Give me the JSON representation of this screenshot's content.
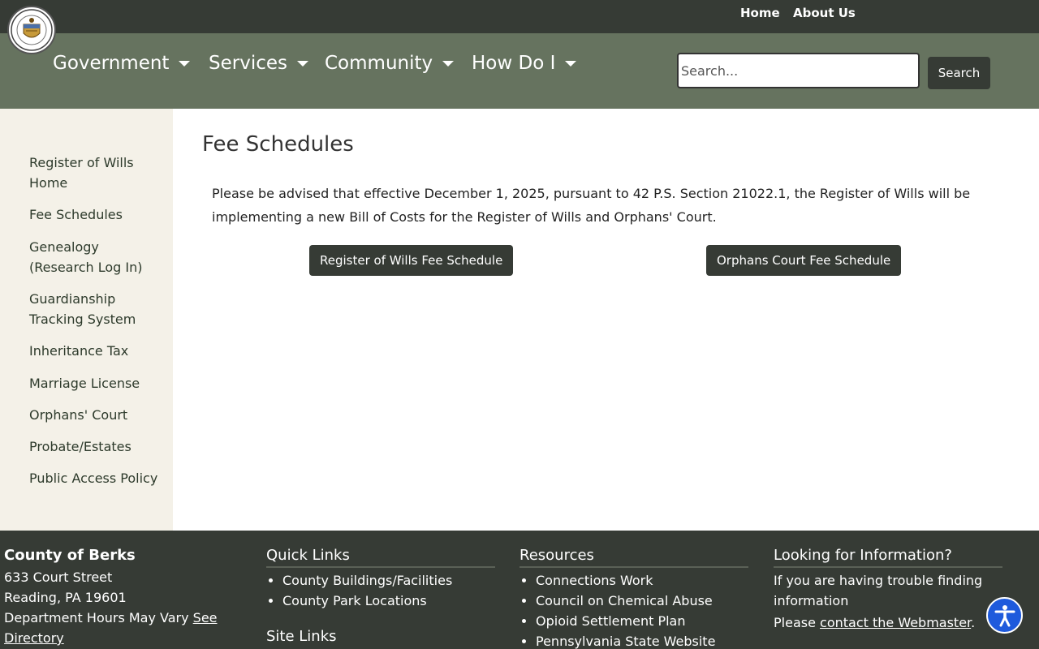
{
  "topbar": {
    "home_label": "Home",
    "about_label": "About Us"
  },
  "seal": {
    "icon": "county-seal-icon"
  },
  "nav": {
    "items": [
      {
        "label": "Government"
      },
      {
        "label": "Services"
      },
      {
        "label": "Community"
      },
      {
        "label": "How Do I"
      }
    ],
    "search": {
      "placeholder": "Search...",
      "button_label": "Search"
    }
  },
  "sidebar": {
    "items": [
      {
        "label": "Register of Wills Home"
      },
      {
        "label": "Fee Schedules"
      },
      {
        "label": "Genealogy (Research Log In)"
      },
      {
        "label": "Guardianship Tracking System"
      },
      {
        "label": "Inheritance Tax"
      },
      {
        "label": "Marriage License"
      },
      {
        "label": "Orphans' Court"
      },
      {
        "label": "Probate/Estates"
      },
      {
        "label": "Public Access Policy"
      }
    ]
  },
  "main": {
    "title": "Fee Schedules",
    "intro": "Please be advised that effective December 1, 2025, pursuant to 42 P.S. Section 21022.1, the Register of Wills will be implementing a new Bill of Costs for the Register of Wills and Orphans' Court.",
    "buttons": [
      {
        "label": "Register of Wills Fee Schedule"
      },
      {
        "label": "Orphans Court Fee Schedule"
      }
    ]
  },
  "footer": {
    "org": {
      "name": "County of Berks",
      "address1": "633 Court Street",
      "address2": "Reading, PA 19601",
      "hours_text": "Department Hours May Vary ",
      "hours_link": "See Directory"
    },
    "quick_links": {
      "title": "Quick Links",
      "items": [
        "County Buildings/Facilities",
        "County Park Locations"
      ]
    },
    "site_links": {
      "title": "Site Links"
    },
    "resources": {
      "title": "Resources",
      "items": [
        "Connections Work",
        "Council on Chemical Abuse",
        "Opioid Settlement Plan",
        "Pennsylvania State Website"
      ]
    },
    "info": {
      "title": "Looking for Information?",
      "text": "If you are having trouble finding information",
      "please": "Please ",
      "link": "contact the Webmaster",
      "period": "."
    }
  },
  "accessibility": {
    "icon": "accessibility-icon"
  },
  "colors": {
    "topbar": "#363b35",
    "navbar": "#66735f",
    "sidebar": "#f4f1e8",
    "button": "#363b35",
    "accessibility": "#1e5adc"
  }
}
